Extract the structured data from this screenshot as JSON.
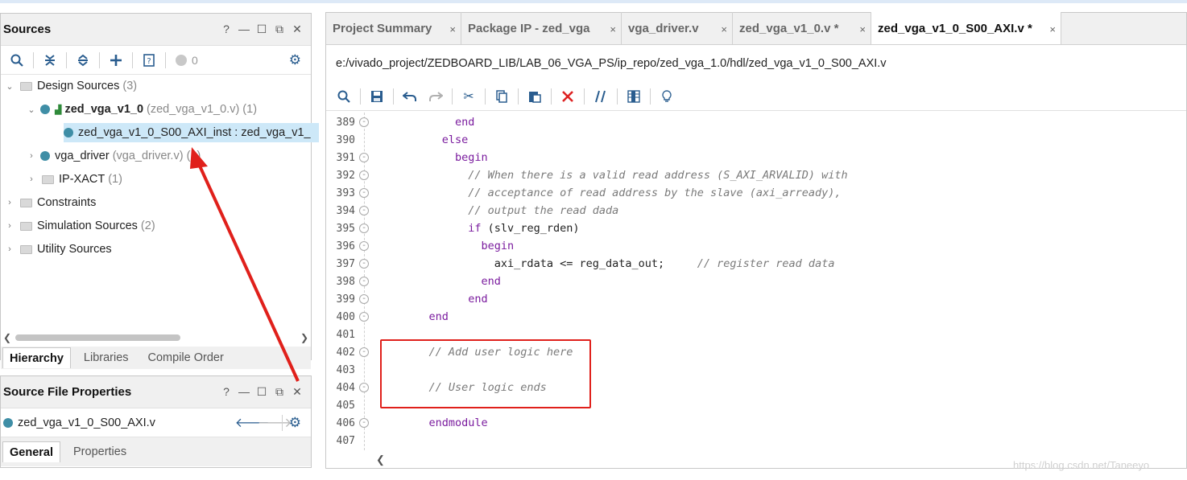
{
  "sources_panel": {
    "title": "Sources",
    "window_controls": [
      "?",
      "—",
      "☐",
      "⧉",
      "✕"
    ],
    "toolbar": {
      "count": "0"
    },
    "tree": [
      {
        "label": "Design Sources",
        "detail": "(3)"
      },
      {
        "label": "zed_vga_v1_0",
        "detail": "(zed_vga_v1_0.v) (1)"
      },
      {
        "label": "zed_vga_v1_0_S00_AXI_inst : zed_vga_v1_",
        "detail": ""
      },
      {
        "label": "vga_driver",
        "detail": "(vga_driver.v) (1)"
      },
      {
        "label": "IP-XACT",
        "detail": "(1)"
      },
      {
        "label": "Constraints",
        "detail": ""
      },
      {
        "label": "Simulation Sources",
        "detail": "(2)"
      },
      {
        "label": "Utility Sources",
        "detail": ""
      }
    ],
    "bottom_tabs": [
      "Hierarchy",
      "Libraries",
      "Compile Order"
    ]
  },
  "properties_panel": {
    "title": "Source File Properties",
    "file": "zed_vga_v1_0_S00_AXI.v",
    "tabs": [
      "General",
      "Properties"
    ]
  },
  "editor": {
    "tabs": [
      {
        "label": "Project Summary"
      },
      {
        "label": "Package IP - zed_vga"
      },
      {
        "label": "vga_driver.v"
      },
      {
        "label": "zed_vga_v1_0.v *"
      },
      {
        "label": "zed_vga_v1_0_S00_AXI.v *"
      }
    ],
    "close_glyph": "×",
    "file_path": "e:/vivado_project/ZEDBOARD_LIB/LAB_06_VGA_PS/ip_repo/zed_vga_1.0/hdl/zed_vga_v1_0_S00_AXI.v",
    "code_lines": [
      {
        "num": "389",
        "indent": "        ",
        "kw": "end",
        "rest": "",
        "comment": ""
      },
      {
        "num": "390",
        "indent": "      ",
        "kw": "else",
        "rest": "",
        "comment": ""
      },
      {
        "num": "391",
        "indent": "        ",
        "kw": "begin",
        "rest": "",
        "comment": ""
      },
      {
        "num": "392",
        "indent": "          ",
        "kw": "",
        "rest": "",
        "comment": "// When there is a valid read address (S_AXI_ARVALID) with"
      },
      {
        "num": "393",
        "indent": "          ",
        "kw": "",
        "rest": "",
        "comment": "// acceptance of read address by the slave (axi_arready),"
      },
      {
        "num": "394",
        "indent": "          ",
        "kw": "",
        "rest": "",
        "comment": "// output the read dada"
      },
      {
        "num": "395",
        "indent": "          ",
        "kw": "if",
        "rest": " (slv_reg_rden)",
        "comment": ""
      },
      {
        "num": "396",
        "indent": "            ",
        "kw": "begin",
        "rest": "",
        "comment": ""
      },
      {
        "num": "397",
        "indent": "              ",
        "kw": "",
        "rest": "axi_rdata <= reg_data_out;     ",
        "comment": "// register read data"
      },
      {
        "num": "398",
        "indent": "            ",
        "kw": "end",
        "rest": "",
        "comment": ""
      },
      {
        "num": "399",
        "indent": "          ",
        "kw": "end",
        "rest": "",
        "comment": ""
      },
      {
        "num": "400",
        "indent": "    ",
        "kw": "end",
        "rest": "",
        "comment": ""
      },
      {
        "num": "401",
        "indent": "",
        "kw": "",
        "rest": "",
        "comment": ""
      },
      {
        "num": "402",
        "indent": "    ",
        "kw": "",
        "rest": "",
        "comment": "// Add user logic here"
      },
      {
        "num": "403",
        "indent": "",
        "kw": "",
        "rest": "",
        "comment": ""
      },
      {
        "num": "404",
        "indent": "    ",
        "kw": "",
        "rest": "",
        "comment": "// User logic ends"
      },
      {
        "num": "405",
        "indent": "",
        "kw": "",
        "rest": "",
        "comment": ""
      },
      {
        "num": "406",
        "indent": "    ",
        "kw": "endmodule",
        "rest": "",
        "comment": ""
      },
      {
        "num": "407",
        "indent": "",
        "kw": "",
        "rest": "",
        "comment": ""
      }
    ]
  },
  "watermark": "https://blog.csdn.net/Taneeyo",
  "colors": {
    "annotation": "#e0201b",
    "keyword": "#7a1b9e",
    "comment": "#7a7a7a",
    "accent": "#2a5d8f",
    "selection": "#cde8f8"
  }
}
